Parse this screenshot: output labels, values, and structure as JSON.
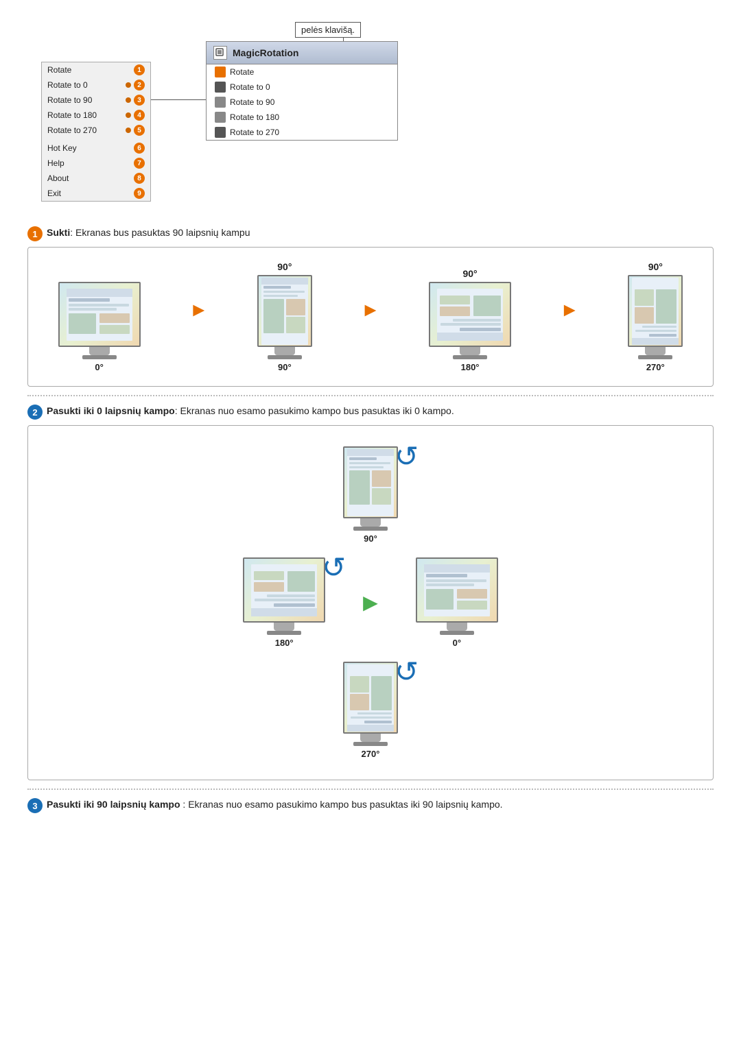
{
  "top": {
    "peles_label": "pelės klavišą.",
    "context_menu": {
      "items": [
        {
          "label": "Rotate",
          "num": "1",
          "has_dot": false
        },
        {
          "label": "Rotate to 0",
          "num": "2",
          "has_dot": true
        },
        {
          "label": "Rotate to 90",
          "num": "3",
          "has_dot": true
        },
        {
          "label": "Rotate to 180",
          "num": "4",
          "has_dot": true
        },
        {
          "label": "Rotate to 270",
          "num": "5",
          "has_dot": true
        },
        {
          "label": "Hot Key",
          "num": "6",
          "has_dot": false
        },
        {
          "label": "Help",
          "num": "7",
          "has_dot": false
        },
        {
          "label": "About",
          "num": "8",
          "has_dot": false
        },
        {
          "label": "Exit",
          "num": "9",
          "has_dot": false
        }
      ]
    },
    "magic_panel": {
      "title": "MagicRotation",
      "items": [
        {
          "label": "Rotate"
        },
        {
          "label": "Rotate to 0"
        },
        {
          "label": "Rotate to 90"
        },
        {
          "label": "Rotate to 180"
        },
        {
          "label": "Rotate to 270"
        }
      ]
    }
  },
  "step1": {
    "number": "1",
    "label_bold": "Sukti",
    "label_rest": ":  Ekranas bus pasuktas 90 laipsnių kampu",
    "degrees_top": [
      "90°",
      "90°",
      "90°"
    ],
    "degrees_bottom": [
      "0°",
      "90°",
      "180°",
      "270°"
    ]
  },
  "step2": {
    "number": "2",
    "label_bold": "Pasukti iki 0 laipsnių kampo",
    "label_rest": ": Ekranas nuo esamo pasukimo kampo bus pasuktas iki 0 kampo.",
    "degrees": [
      "90°",
      "180°",
      "0°",
      "270°"
    ]
  },
  "step3": {
    "number": "3",
    "label_bold": "Pasukti iki 90 laipsnių kampo",
    "label_rest": " : Ekranas nuo esamo pasukimo kampo bus pasuktas iki 90 laipsnių kampo."
  }
}
